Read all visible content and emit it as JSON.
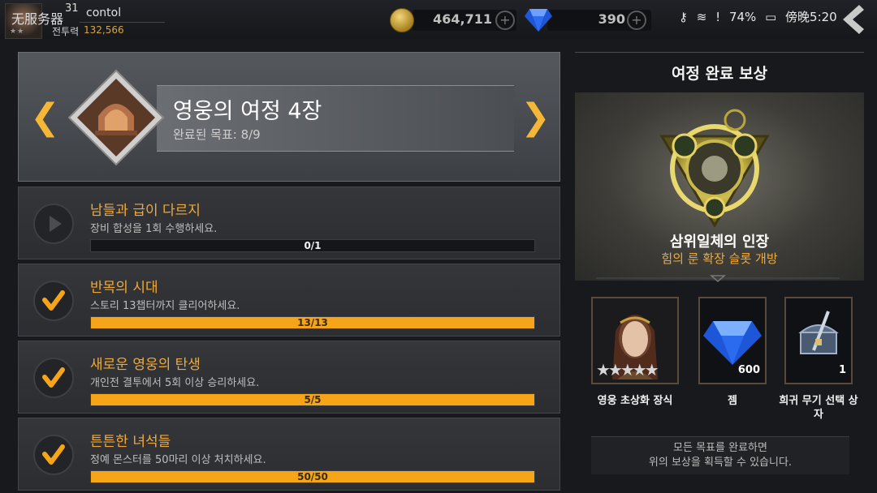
{
  "topbar": {
    "watermark": "无服务器",
    "level": "31",
    "username": "contol",
    "power_label": "전투력",
    "power_value": "132,566",
    "gold": "464,711",
    "gems": "390",
    "battery": "74%",
    "time": "傍晚5:20",
    "icons": [
      "key-icon",
      "wifi-icon",
      "alert-icon",
      "battery-icon"
    ]
  },
  "chapter": {
    "title": "영웅의 여정 4장",
    "progress": "완료된 목표: 8/9",
    "done": 8,
    "total": 9
  },
  "quests": [
    {
      "title": "남들과 급이 다르지",
      "desc": "장비 합성을 1회 수행하세요.",
      "progress_text": "0/1",
      "current": 0,
      "target": 1,
      "completed": false
    },
    {
      "title": "반목의 시대",
      "desc": "스토리 13챕터까지 클리어하세요.",
      "progress_text": "13/13",
      "current": 13,
      "target": 13,
      "completed": true
    },
    {
      "title": "새로운 영웅의 탄생",
      "desc": "개인전 결투에서 5회 이상 승리하세요.",
      "progress_text": "5/5",
      "current": 5,
      "target": 5,
      "completed": true
    },
    {
      "title": "튼튼한 녀석들",
      "desc": "정예 몬스터를 50마리 이상 처치하세요.",
      "progress_text": "50/50",
      "current": 50,
      "target": 50,
      "completed": true
    }
  ],
  "reward": {
    "title": "여정 완료 보상",
    "main_name": "삼위일체의 인장",
    "main_desc": "힘의 룬 확장 슬롯 개방",
    "items": [
      {
        "label": "영웅 초상화 장식",
        "count": "",
        "icon": "portrait-icon"
      },
      {
        "label": "젬",
        "count": "600",
        "icon": "gem-icon"
      },
      {
        "label": "희귀 무기 선택 상자",
        "count": "1",
        "icon": "chest-icon"
      }
    ],
    "notice_line1": "모든 목표를 완료하면",
    "notice_line2": "위의 보상을 획득할 수 있습니다."
  },
  "colors": {
    "accent": "#f5a517",
    "title_orange": "#f0a93a",
    "arrow": "#f5b736"
  }
}
